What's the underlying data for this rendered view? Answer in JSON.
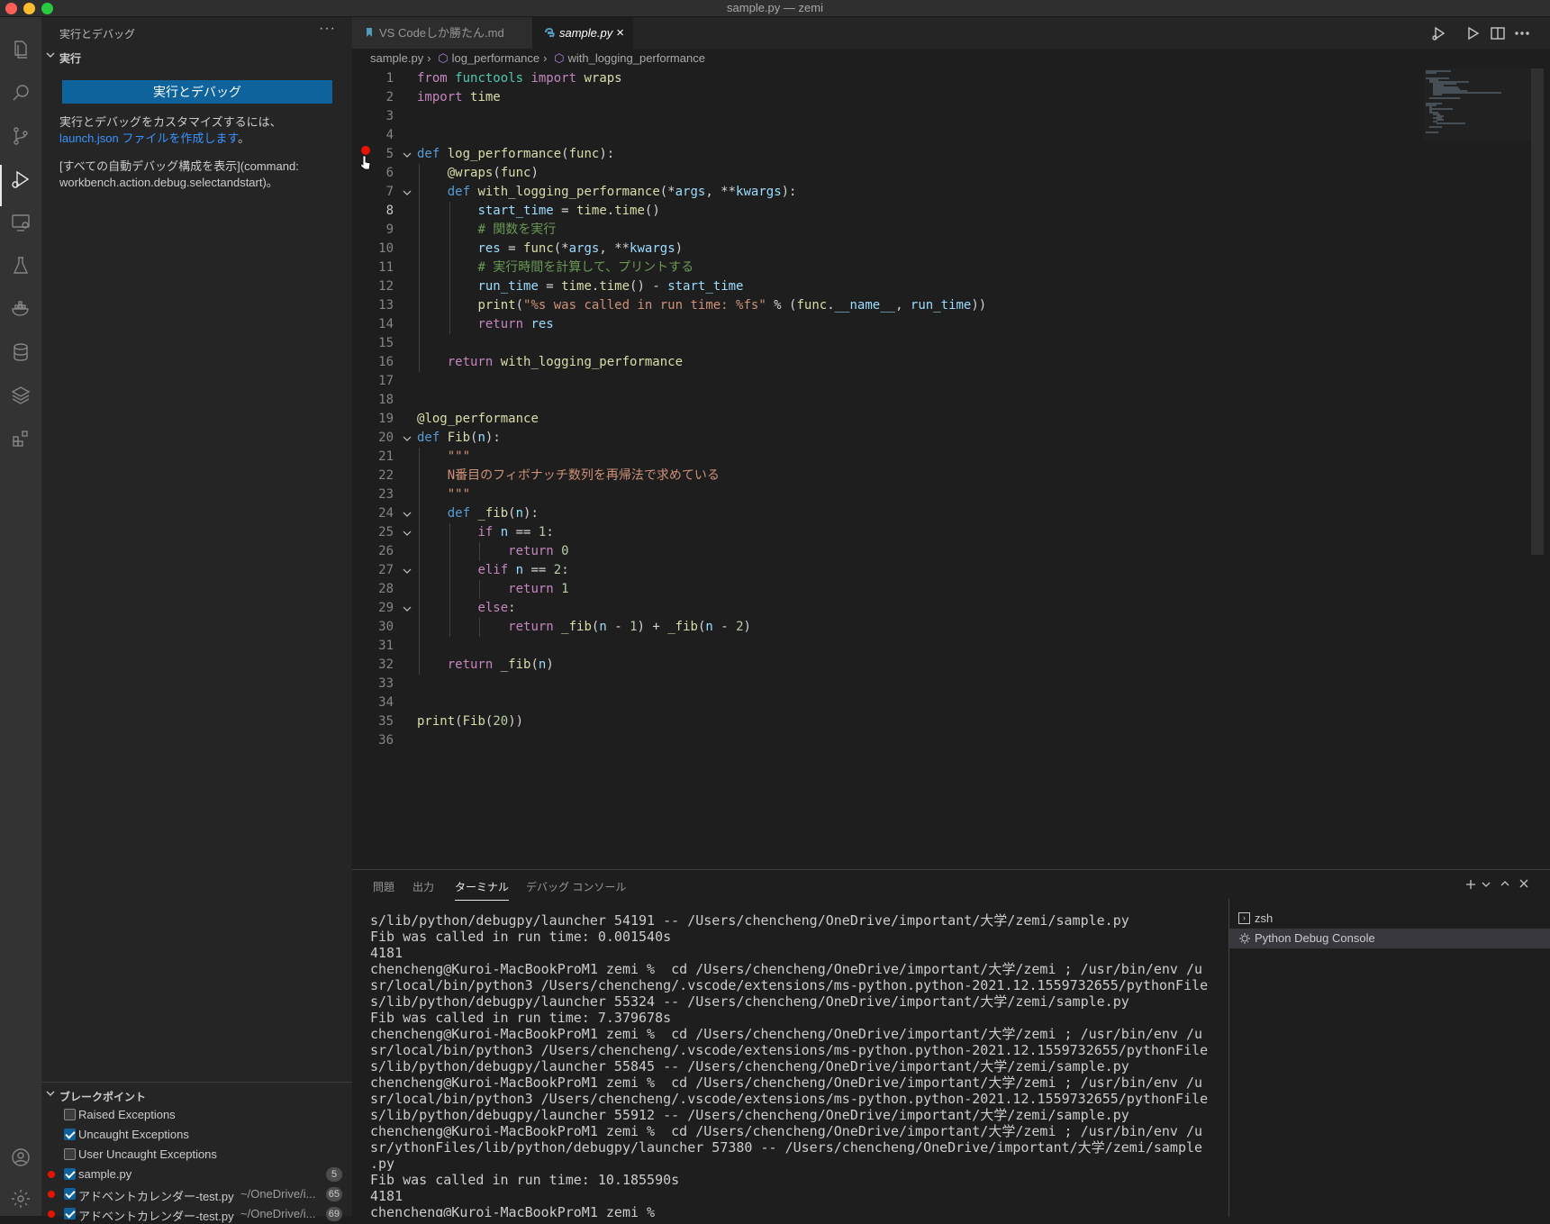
{
  "window": {
    "title": "sample.py — zemi"
  },
  "activity_bar": {
    "items": [
      "explorer-icon",
      "search-icon",
      "source-control-icon",
      "run-debug-icon",
      "remote-explorer-icon",
      "testing-icon",
      "docker-icon",
      "database-icon",
      "layers-icon",
      "extensions-icon"
    ],
    "bottom": [
      "account-icon",
      "settings-gear-icon"
    ]
  },
  "sidebar": {
    "header": "実行とデバッグ",
    "run_section": "実行",
    "run_button": "実行とデバッグ",
    "customize_text": "実行とデバッグをカスタマイズするには、",
    "launch_link": "launch.json ファイルを作成します",
    "launch_suffix": "。",
    "show_all_text": "[すべての自動デバッグ構成を表示](command:",
    "show_all_text2": "workbench.action.debug.selectandstart)。",
    "breakpoints_section": "ブレークポイント",
    "breakpoints": [
      {
        "label": "Raised Exceptions",
        "checked": false
      },
      {
        "label": "Uncaught Exceptions",
        "checked": true
      },
      {
        "label": "User Uncaught Exceptions",
        "checked": false
      },
      {
        "label": "sample.py",
        "checked": true,
        "path": "",
        "line": "5"
      },
      {
        "label": "アドベントカレンダー-test.py",
        "checked": true,
        "path": "~/OneDrive/i...",
        "line": "65"
      },
      {
        "label": "アドベントカレンダー-test.py",
        "checked": true,
        "path": "~/OneDrive/i...",
        "line": "69"
      }
    ]
  },
  "tabs": [
    {
      "label": "VS Codeしか勝たん.md",
      "active": false
    },
    {
      "label": "sample.py",
      "active": true,
      "close": "×"
    }
  ],
  "breadcrumbs": [
    "sample.py",
    "log_performance",
    "with_logging_performance"
  ],
  "code_lines": [
    "from functools import wraps",
    "import time",
    "",
    "",
    "def log_performance(func):",
    "    @wraps(func)",
    "    def with_logging_performance(*args, **kwargs):",
    "        start_time = time.time()",
    "        # 関数を実行",
    "        res = func(*args, **kwargs)",
    "        # 実行時間を計算して、プリントする",
    "        run_time = time.time() - start_time",
    "        print(\"%s was called in run time: %fs\" % (func.__name__, run_time))",
    "        return res",
    "",
    "    return with_logging_performance",
    "",
    "",
    "@log_performance",
    "def Fib(n):",
    "    \"\"\"",
    "    N番目のフィボナッチ数列を再帰法で求めている",
    "    \"\"\"",
    "    def _fib(n):",
    "        if n == 1:",
    "            return 0",
    "        elif n == 2:",
    "            return 1",
    "        else:",
    "            return _fib(n - 1) + _fib(n - 2)",
    "",
    "    return _fib(n)",
    "",
    "",
    "print(Fib(20))",
    ""
  ],
  "panel": {
    "tabs": [
      "問題",
      "出力",
      "ターミナル",
      "デバッグ コンソール"
    ],
    "active_tab": "ターミナル",
    "terminal_lines": [
      "s/lib/python/debugpy/launcher 54191 -- /Users/chencheng/OneDrive/important/大学/zemi/sample.py",
      "Fib was called in run time: 0.001540s",
      "4181",
      "chencheng@Kuroi-MacBookProM1 zemi %  cd /Users/chencheng/OneDrive/important/大学/zemi ; /usr/bin/env /u",
      "sr/local/bin/python3 /Users/chencheng/.vscode/extensions/ms-python.python-2021.12.1559732655/pythonFile",
      "s/lib/python/debugpy/launcher 55324 -- /Users/chencheng/OneDrive/important/大学/zemi/sample.py",
      "Fib was called in run time: 7.379678s",
      "chencheng@Kuroi-MacBookProM1 zemi %  cd /Users/chencheng/OneDrive/important/大学/zemi ; /usr/bin/env /u",
      "sr/local/bin/python3 /Users/chencheng/.vscode/extensions/ms-python.python-2021.12.1559732655/pythonFile",
      "s/lib/python/debugpy/launcher 55845 -- /Users/chencheng/OneDrive/important/大学/zemi/sample.py",
      "chencheng@Kuroi-MacBookProM1 zemi %  cd /Users/chencheng/OneDrive/important/大学/zemi ; /usr/bin/env /u",
      "sr/local/bin/python3 /Users/chencheng/.vscode/extensions/ms-python.python-2021.12.1559732655/pythonFile",
      "s/lib/python/debugpy/launcher 55912 -- /Users/chencheng/OneDrive/important/大学/zemi/sample.py",
      "chencheng@Kuroi-MacBookProM1 zemi %  cd /Users/chencheng/OneDrive/important/大学/zemi ; /usr/bin/env /u",
      "sr/ythonFiles/lib/python/debugpy/launcher 57380 -- /Users/chencheng/OneDrive/important/大学/zemi/sample",
      ".py",
      "Fib was called in run time: 10.185590s",
      "4181",
      "chencheng@Kuroi-MacBookProM1 zemi % "
    ],
    "terminals": [
      {
        "label": "zsh",
        "selected": false
      },
      {
        "label": "Python Debug Console",
        "selected": true
      }
    ]
  },
  "colors": {
    "accent": "#0e639c",
    "link": "#3794ff",
    "breakpoint": "#e51400"
  }
}
